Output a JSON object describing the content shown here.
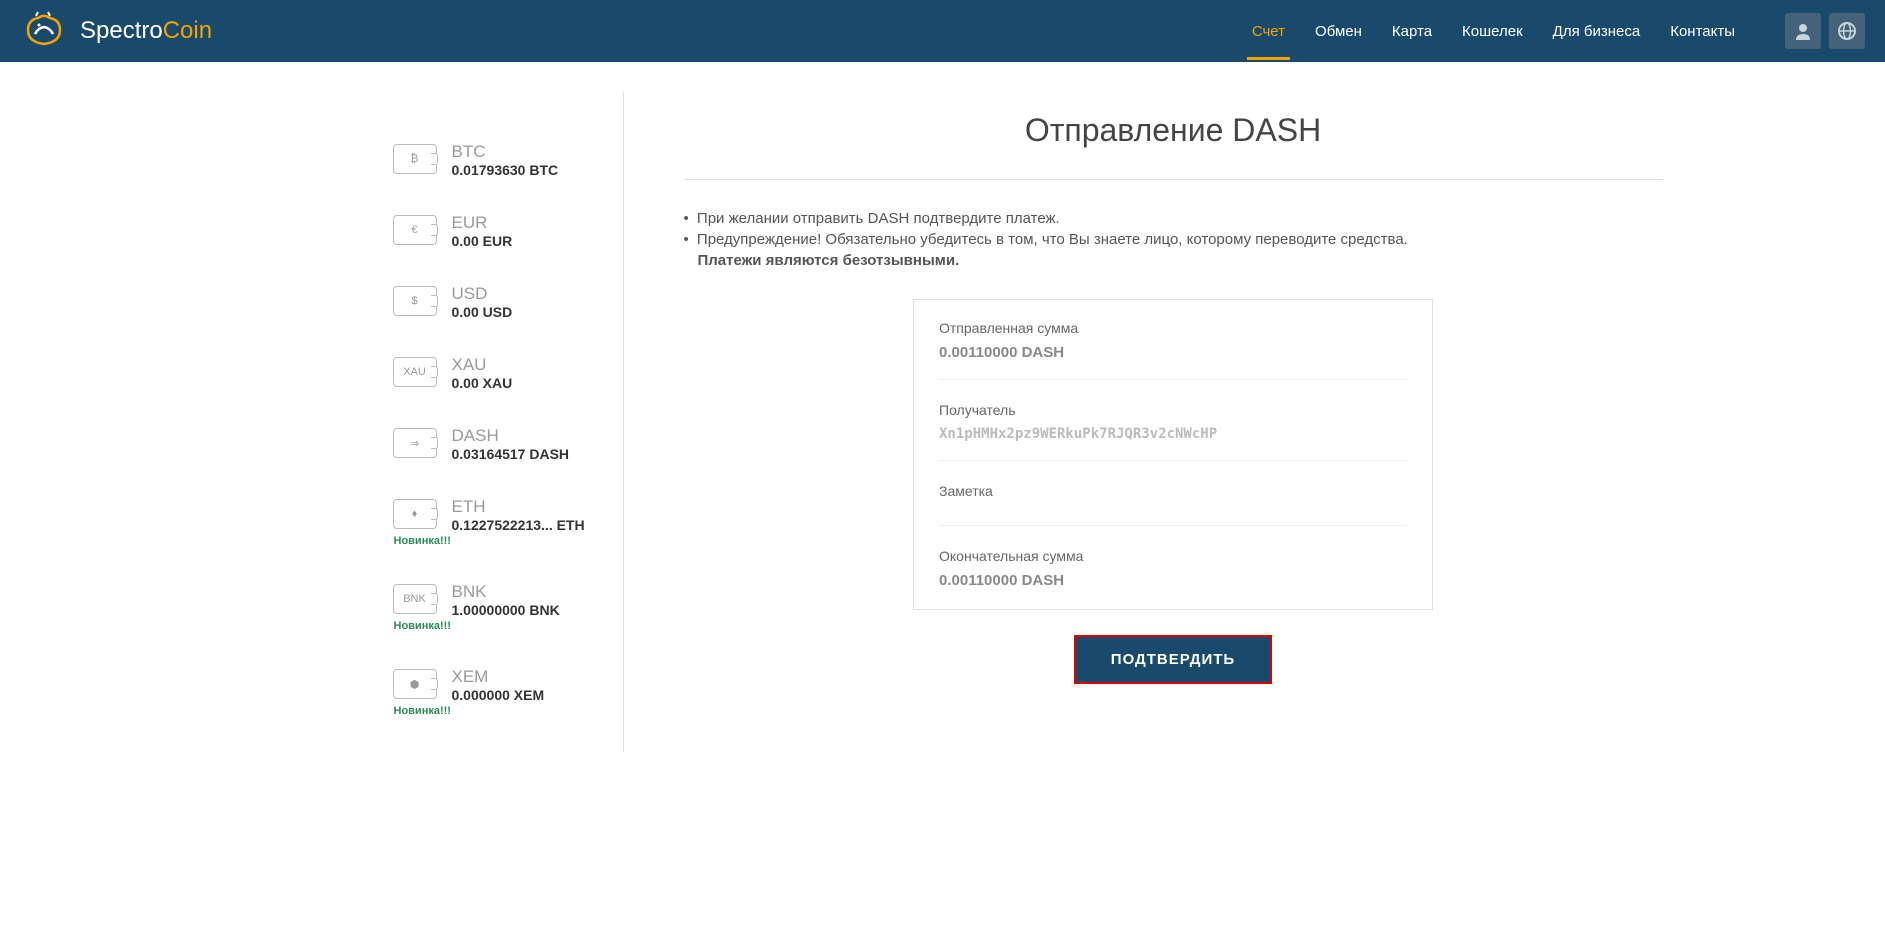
{
  "brand": {
    "part1": "Spectro",
    "part2": "Coin"
  },
  "nav": {
    "account": "Счет",
    "exchange": "Обмен",
    "card": "Карта",
    "wallet": "Кошелек",
    "business": "Для бизнеса",
    "contacts": "Контакты"
  },
  "sidebar": {
    "wallets": [
      {
        "sym": "₿",
        "code": "BTC",
        "balance": "0.01793630 BTC",
        "badge": ""
      },
      {
        "sym": "€",
        "code": "EUR",
        "balance": "0.00 EUR",
        "badge": ""
      },
      {
        "sym": "$",
        "code": "USD",
        "balance": "0.00 USD",
        "badge": ""
      },
      {
        "sym": "XAU",
        "code": "XAU",
        "balance": "0.00 XAU",
        "badge": ""
      },
      {
        "sym": "⇒",
        "code": "DASH",
        "balance": "0.03164517 DASH",
        "badge": ""
      },
      {
        "sym": "♦",
        "code": "ETH",
        "balance": "0.1227522213... ETH",
        "badge": "Новинка!!!"
      },
      {
        "sym": "BNK",
        "code": "BNK",
        "balance": "1.00000000 BNK",
        "badge": "Новинка!!!"
      },
      {
        "sym": "⬢",
        "code": "XEM",
        "balance": "0.000000 XEM",
        "badge": "Новинка!!!"
      }
    ]
  },
  "main": {
    "title": "Отправление DASH",
    "warn1": "При желании отправить DASH подтвердите платеж.",
    "warn2_a": "Предупреждение! Обязательно убедитесь в том, что Вы знаете лицо, которому переводите средства.",
    "warn2_b": "Платежи являются безотзывными.",
    "fields": {
      "sent_label": "Отправленная сумма",
      "sent_value": "0.00110000 DASH",
      "recipient_label": "Получатель",
      "recipient_value": "Xn1pHMHx2pz9WERkuPk7RJQR3v2cNWcHP",
      "note_label": "Заметка",
      "note_value": "",
      "final_label": "Окончательная сумма",
      "final_value": "0.00110000 DASH"
    },
    "confirm": "ПОДТВЕРДИТЬ"
  }
}
